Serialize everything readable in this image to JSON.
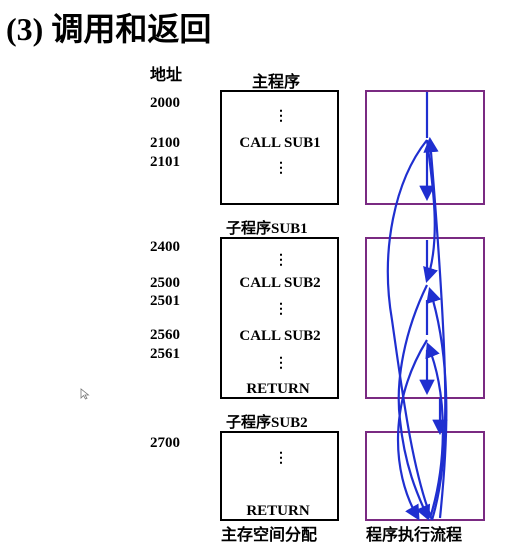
{
  "title": "(3) 调用和返回",
  "address_header": "地址",
  "addresses": [
    "2000",
    "2100",
    "2101",
    "2400",
    "2500",
    "2501",
    "2560",
    "2561",
    "2700"
  ],
  "main_program": {
    "label": "主程序",
    "dots": "⋮",
    "call": "CALL SUB1"
  },
  "sub1": {
    "label": "子程序SUB1",
    "dots": "⋮",
    "call1": "CALL SUB2",
    "call2": "CALL SUB2",
    "return": "RETURN"
  },
  "sub2": {
    "label": "子程序SUB2",
    "dots": "⋮",
    "return": "RETURN"
  },
  "footer_left": "主存空间分配",
  "footer_right": "程序执行流程",
  "colors": {
    "box_border": "#000000",
    "flow_border": "#7a2a82",
    "arrow": "#1f2fd0"
  }
}
